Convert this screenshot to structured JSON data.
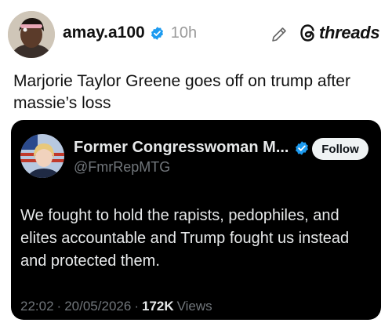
{
  "post": {
    "username": "amay.a100",
    "time": "10h",
    "brand": "threads",
    "text": "Marjorie Taylor Greene goes off on trump after massie’s loss"
  },
  "embed": {
    "name": "Former Congresswoman M...",
    "handle": "@FmrRepMTG",
    "follow_label": "Follow",
    "body": "We fought to hold the rapists, pedophiles, and elites accountable and Trump fought us instead and protected them.",
    "time": "22:02",
    "date": "20/05/2026",
    "sep1": "·",
    "sep2": "·",
    "views_count": "172K",
    "views_label": "Views"
  },
  "icons": {
    "verified": "verified-badge-icon",
    "edit": "pencil-icon",
    "threads": "threads-logo-icon"
  },
  "colors": {
    "verified_blue": "#1d9bf0",
    "card_bg": "#000000",
    "muted": "#71767b"
  }
}
